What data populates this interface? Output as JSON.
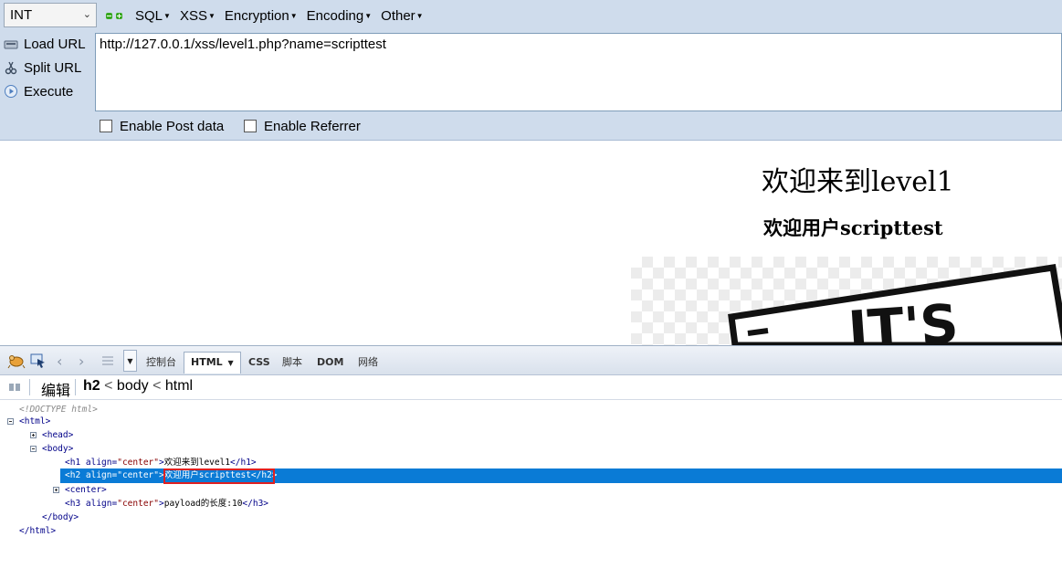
{
  "hackbar": {
    "select_value": "INT",
    "menus": [
      "SQL",
      "XSS",
      "Encryption",
      "Encoding",
      "Other"
    ],
    "load_url": "Load URL",
    "split_url": "Split URL",
    "execute": "Execute",
    "url": "http://127.0.0.1/xss/level1.php?name=scripttest",
    "post_data": "Enable Post data",
    "referrer": "Enable Referrer"
  },
  "page": {
    "h1": "欢迎来到level1",
    "h2": "欢迎用户scripttest",
    "image_text": "IT'S"
  },
  "firebug": {
    "tabs": {
      "console": "控制台",
      "html": "HTML",
      "css": "CSS",
      "script": "脚本",
      "dom": "DOM",
      "net": "网络"
    },
    "edit": "编辑",
    "breadcrumb": {
      "current": "h2",
      "sep1": "<",
      "body": "body",
      "sep2": "<",
      "html": "html"
    },
    "tree": {
      "doctype": "<!DOCTYPE html>",
      "html_open": "<html>",
      "head": "<head>",
      "body_open": "<body>",
      "h1_open": "<h1 ",
      "h1_attr": "align=",
      "h1_val": "\"center\"",
      "h1_close_bracket": ">",
      "h1_text": "欢迎来到level1",
      "h1_end": "</h1>",
      "h2_open": "<h2 ",
      "h2_attr": "align=",
      "h2_val": "\"center\"",
      "h2_close_bracket": ">",
      "h2_text": "欢迎用户scripttest",
      "h2_end": "</h2>",
      "center": "<center>",
      "h3_open": "<h3 ",
      "h3_attr": "align=",
      "h3_val": "\"center\"",
      "h3_close_bracket": ">",
      "h3_text": "payload的长度:10",
      "h3_end": "</h3>",
      "body_close": "</body>",
      "html_close": "</html>"
    }
  }
}
